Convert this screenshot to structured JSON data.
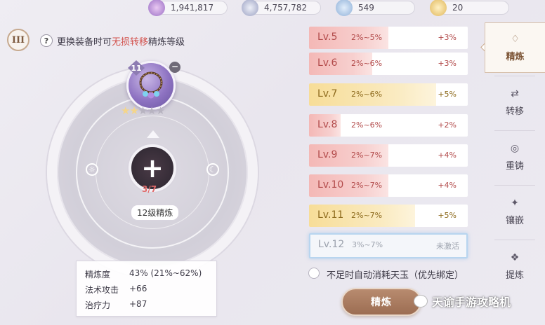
{
  "currencies": [
    {
      "icon": "star-crystal-icon",
      "value": "1,941,817"
    },
    {
      "icon": "silver-coin-icon",
      "value": "4,757,782"
    },
    {
      "icon": "blue-gem-icon",
      "value": "549"
    },
    {
      "icon": "gold-medal-icon",
      "value": "20"
    }
  ],
  "header": {
    "tier": "III",
    "help": "?",
    "hint_pre": "更换装备时可",
    "hint_highlight": "无损转移",
    "hint_post": "精炼等级"
  },
  "equipment": {
    "level_badge": "11",
    "remove": "−",
    "stars_filled": 2,
    "stars_total": 5,
    "center_plus": "+",
    "count": "3/7",
    "refine_level": "12级精炼"
  },
  "stats": {
    "rows": [
      {
        "label": "精炼度",
        "value": "43% (21%~62%)"
      },
      {
        "label": "法术攻击",
        "value": "+66"
      },
      {
        "label": "治疗力",
        "value": "+87"
      }
    ]
  },
  "levels": [
    {
      "name": "Lv.5",
      "range": "2%~5%",
      "bonus": "+3%",
      "style": "red",
      "fill": 0.5
    },
    {
      "name": "Lv.6",
      "range": "2%~6%",
      "bonus": "+3%",
      "style": "red",
      "fill": 0.4
    },
    {
      "name": "Lv.7",
      "range": "2%~6%",
      "bonus": "+5%",
      "style": "gold",
      "fill": 0.8
    },
    {
      "name": "Lv.8",
      "range": "2%~6%",
      "bonus": "+2%",
      "style": "red",
      "fill": 0.2
    },
    {
      "name": "Lv.9",
      "range": "2%~7%",
      "bonus": "+4%",
      "style": "red",
      "fill": 0.5
    },
    {
      "name": "Lv.10",
      "range": "2%~7%",
      "bonus": "+4%",
      "style": "red",
      "fill": 0.5
    },
    {
      "name": "Lv.11",
      "range": "2%~7%",
      "bonus": "+5%",
      "style": "gold",
      "fill": 0.67
    },
    {
      "name": "Lv.12",
      "range": "3%~7%",
      "bonus": "未激活",
      "style": "locked",
      "fill": 0
    }
  ],
  "auto_consume": {
    "label": "不足时自动消耗天玉（优先绑定）",
    "checked": false
  },
  "refine_button": "精炼",
  "watermark": "天谕手游攻略机",
  "nav": [
    {
      "label": "精炼",
      "icon": "refine-icon",
      "active": true
    },
    {
      "label": "转移",
      "icon": "transfer-icon",
      "active": false
    },
    {
      "label": "重铸",
      "icon": "recast-icon",
      "active": false
    },
    {
      "label": "镶嵌",
      "icon": "inlay-icon",
      "active": false
    },
    {
      "label": "提炼",
      "icon": "extract-icon",
      "active": false
    }
  ]
}
